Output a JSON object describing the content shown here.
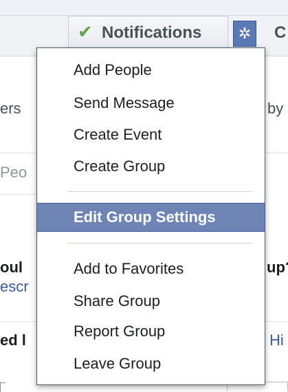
{
  "toolbar": {
    "notifications_label": "Notifications",
    "next_tab_partial": "C"
  },
  "background": {
    "left_texts": [
      "ers",
      "Peo",
      "oul",
      "escr",
      "ed l"
    ],
    "right_texts": [
      "by",
      "up?",
      "Hi"
    ]
  },
  "menu": {
    "items": [
      {
        "label": "Add People"
      },
      {
        "label": "Send Message"
      },
      {
        "label": "Create Event"
      },
      {
        "label": "Create Group"
      },
      {
        "label": "Edit Group Settings",
        "highlighted": true
      },
      {
        "label": "Add to Favorites"
      },
      {
        "label": "Share Group"
      },
      {
        "label": "Report Group"
      },
      {
        "label": "Leave Group"
      }
    ]
  },
  "colors": {
    "menu_highlight": "#6d84b4",
    "gear_button": "#5b7ab5",
    "check": "#62a34b",
    "link": "#3b5998"
  },
  "icons": {
    "check": "check-icon",
    "gear": "gear-icon"
  }
}
